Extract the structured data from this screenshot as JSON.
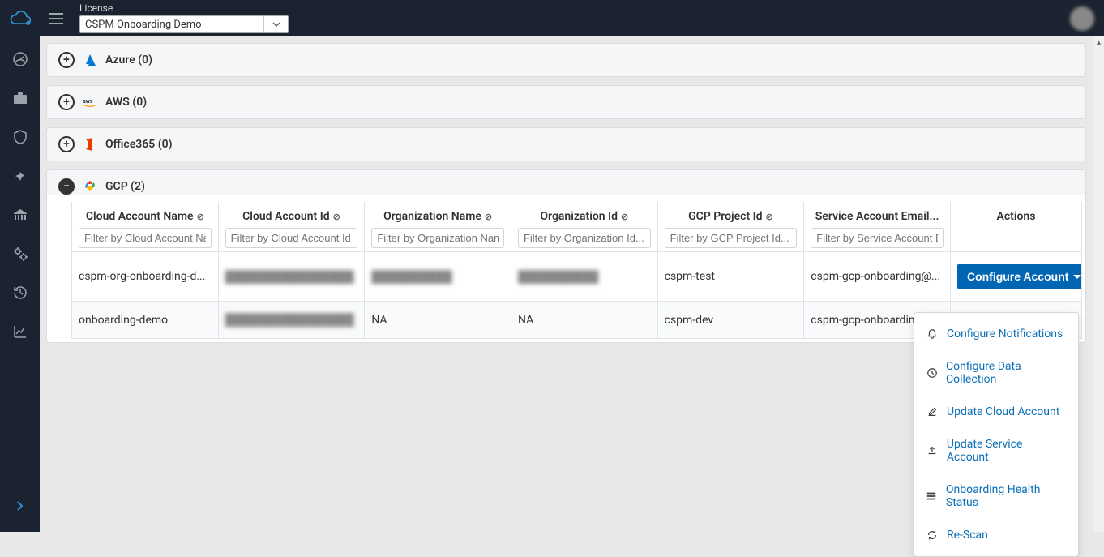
{
  "header": {
    "license_label": "License",
    "license_value": "CSPM Onboarding Demo"
  },
  "providers": {
    "azure": {
      "label": "Azure",
      "count": 0,
      "expanded": false
    },
    "aws": {
      "label": "AWS",
      "count": 0,
      "expanded": false
    },
    "office365": {
      "label": "Office365",
      "count": 0,
      "expanded": false
    },
    "gcp": {
      "label": "GCP",
      "count": 2,
      "expanded": true
    }
  },
  "columns": [
    {
      "label": "Cloud Account Name",
      "placeholder": "Filter by Cloud Account Name..."
    },
    {
      "label": "Cloud Account Id",
      "placeholder": "Filter by Cloud Account Id..."
    },
    {
      "label": "Organization Name",
      "placeholder": "Filter by Organization Name..."
    },
    {
      "label": "Organization Id",
      "placeholder": "Filter by Organization Id..."
    },
    {
      "label": "GCP Project Id",
      "placeholder": "Filter by GCP Project Id..."
    },
    {
      "label": "Service Account Email...",
      "placeholder": "Filter by Service Account Email..."
    },
    {
      "label": "Actions",
      "placeholder": ""
    }
  ],
  "rows": [
    {
      "name": "cspm-org-onboarding-d...",
      "account_id_hidden": true,
      "org_name_hidden": true,
      "org_id_hidden": true,
      "project": "cspm-test",
      "email": "cspm-gcp-onboarding@...",
      "action_label": "Configure Account"
    },
    {
      "name": "onboarding-demo",
      "account_id_hidden": true,
      "org_name": "NA",
      "org_id": "NA",
      "project": "cspm-dev",
      "email": "cspm-gcp-onboarding..."
    }
  ],
  "menu": {
    "items": [
      {
        "icon": "bell",
        "label": "Configure Notifications"
      },
      {
        "icon": "clock",
        "label": "Configure Data Collection"
      },
      {
        "icon": "edit",
        "label": "Update Cloud Account"
      },
      {
        "icon": "upload",
        "label": "Update Service Account"
      },
      {
        "icon": "list",
        "label": "Onboarding Health Status"
      },
      {
        "icon": "refresh",
        "label": "Re-Scan"
      }
    ]
  }
}
